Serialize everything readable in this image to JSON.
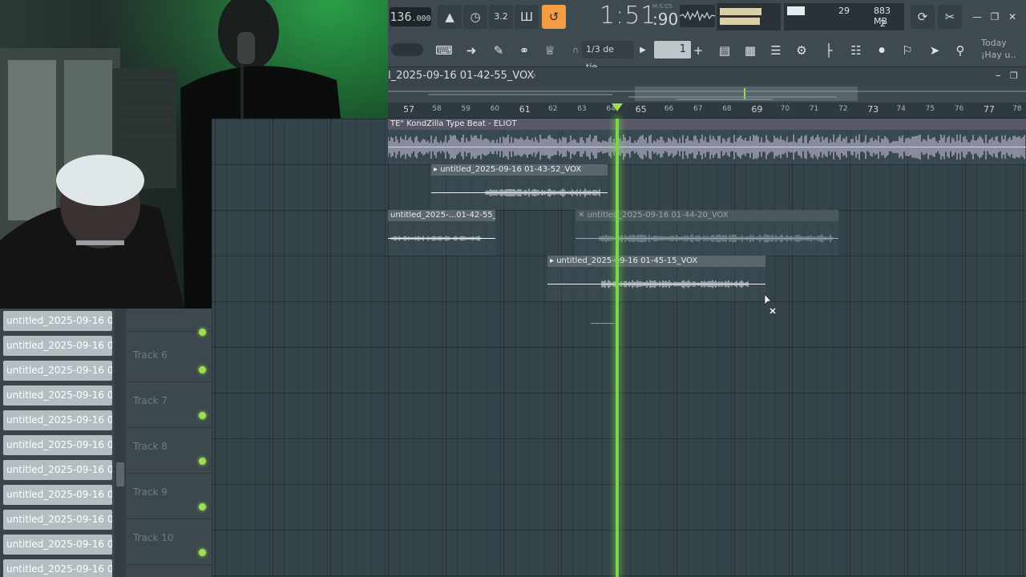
{
  "toolbar": {
    "tempo_int": "136",
    "tempo_dec": ".000",
    "time_main": "1:51",
    "time_sub": ":90",
    "time_format": "M:S:CS",
    "cpu_value": "29",
    "memory": "883 MB",
    "poly": "2",
    "snap_label": "1/3 de tie..",
    "pattern_number": "1",
    "news_line1": "Today",
    "news_line2": "¡Hay u..",
    "accent_color": "#f39c43",
    "icons": {
      "metronome": "metronome-icon",
      "countin": "count-in-icon",
      "loop_record": "loop-record-icon",
      "typing_keyboard": "typing-keyboard-icon",
      "undo": "undo-icon",
      "cut": "cut-icon"
    }
  },
  "playlist": {
    "title": "l_2025-09-16 01-42-55_VOX",
    "ruler": [
      {
        "n": "57",
        "major": true
      },
      {
        "n": "58"
      },
      {
        "n": "59"
      },
      {
        "n": "60"
      },
      {
        "n": "61",
        "major": true
      },
      {
        "n": "62"
      },
      {
        "n": "63"
      },
      {
        "n": "64"
      },
      {
        "n": "65",
        "major": true
      },
      {
        "n": "66"
      },
      {
        "n": "67"
      },
      {
        "n": "68"
      },
      {
        "n": "69",
        "major": true
      },
      {
        "n": "70"
      },
      {
        "n": "71"
      },
      {
        "n": "72"
      },
      {
        "n": "73",
        "major": true
      },
      {
        "n": "74"
      },
      {
        "n": "75"
      },
      {
        "n": "76"
      },
      {
        "n": "77",
        "major": true
      },
      {
        "n": "78"
      }
    ],
    "clips": {
      "beat": "TE\" KondZilla Type Beat - ELIOT",
      "vox1": "untitled_2025-09-16 01-43-52_VOX",
      "vox2": "untitled_2025-...01-42-55_VOX",
      "vox3": "untitled_2025-09-16 01-44-20_VOX",
      "vox4": "untitled_2025-09-16 01-45-15_VOX"
    },
    "playhead_color": "#7ad64a"
  },
  "tracks": [
    {
      "name": "Track 6"
    },
    {
      "name": "Track 7"
    },
    {
      "name": "Track 8"
    },
    {
      "name": "Track 9"
    },
    {
      "name": "Track 10"
    }
  ],
  "browser": {
    "items": [
      "untitled_2025-09-16 01..",
      "untitled_2025-09-16 01..",
      "untitled_2025-09-16 01..",
      "untitled_2025-09-16 01..",
      "untitled_2025-09-16 01..",
      "untitled_2025-09-16 01..",
      "untitled_2025-09-16 01..",
      "untitled_2025-09-16 01..",
      "untitled_2025-09-16 01..",
      "untitled_2025-09-16 01..",
      "untitled_2025-09-16 01.."
    ]
  }
}
